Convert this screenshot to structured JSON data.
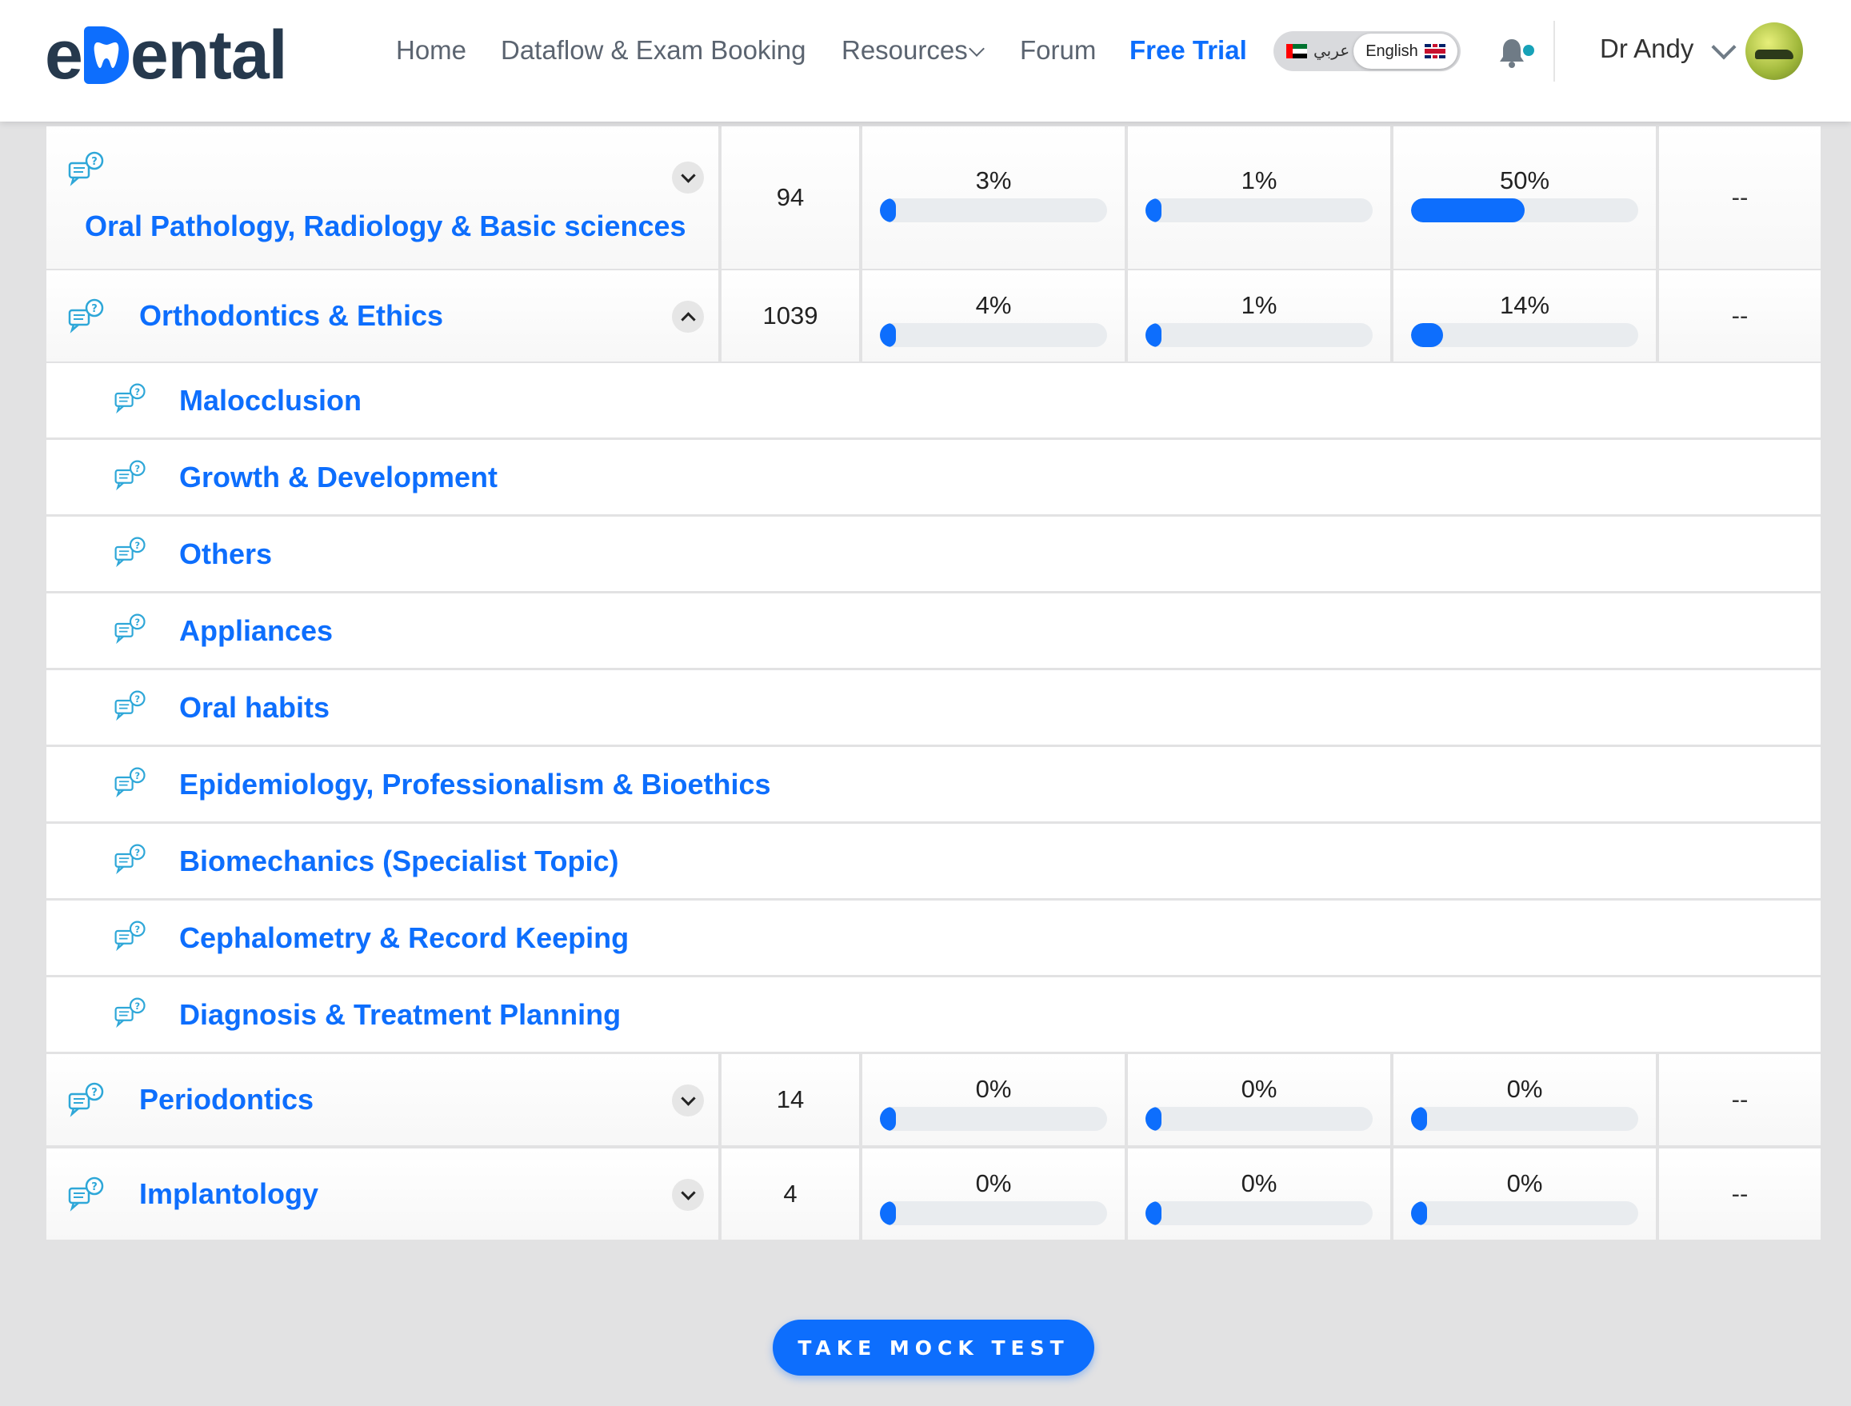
{
  "header": {
    "logo": {
      "prefix": "e",
      "suffix": "ental"
    },
    "nav": [
      {
        "label": "Home"
      },
      {
        "label": "Dataflow & Exam Booking"
      },
      {
        "label": "Resources"
      },
      {
        "label": "Forum"
      },
      {
        "label": "Free Trial"
      }
    ],
    "lang_ar": "عربي",
    "lang_en": "English",
    "user_name": "Dr Andy"
  },
  "topics": [
    {
      "title": "Oral Pathology, Radiology & Basic sciences",
      "count": "94",
      "p1": 3,
      "p1_label": "3%",
      "p2": 1,
      "p2_label": "1%",
      "p3": 50,
      "p3_label": "50%",
      "last": "--",
      "expanded": false
    },
    {
      "title": "Orthodontics & Ethics",
      "count": "1039",
      "p1": 4,
      "p1_label": "4%",
      "p2": 1,
      "p2_label": "1%",
      "p3": 14,
      "p3_label": "14%",
      "last": "--",
      "expanded": true
    },
    {
      "title": "Periodontics",
      "count": "14",
      "p1": 0,
      "p1_label": "0%",
      "p2": 0,
      "p2_label": "0%",
      "p3": 0,
      "p3_label": "0%",
      "last": "--",
      "expanded": false
    },
    {
      "title": "Implantology",
      "count": "4",
      "p1": 0,
      "p1_label": "0%",
      "p2": 0,
      "p2_label": "0%",
      "p3": 0,
      "p3_label": "0%",
      "last": "--",
      "expanded": false
    }
  ],
  "subtopics": [
    "Malocclusion",
    "Growth & Development",
    "Others",
    "Appliances",
    "Oral habits",
    "Epidemiology, Professionalism & Bioethics",
    "Biomechanics (Specialist Topic)",
    "Cephalometry & Record Keeping",
    "Diagnosis & Treatment Planning"
  ],
  "mock_test_label": "TAKE MOCK TEST",
  "colors": {
    "accent": "#0d6efd",
    "heading": "#26394d",
    "track": "#e9ecef"
  },
  "icons": {
    "topic": "question-chat-icon",
    "toggle": "chevron-icon",
    "bell": "bell-icon"
  }
}
